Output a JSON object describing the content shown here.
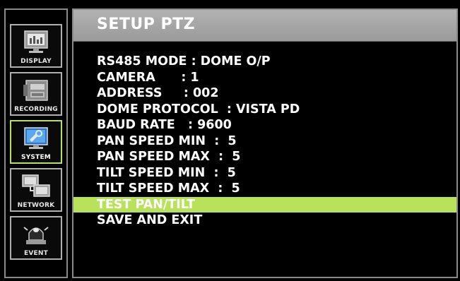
{
  "sidebar": {
    "items": [
      {
        "label": "DISPLAY",
        "icon": "monitor-icon",
        "active": false
      },
      {
        "label": "RECORDING",
        "icon": "recorder-icon",
        "active": false
      },
      {
        "label": "SYSTEM",
        "icon": "system-settings-icon",
        "active": true
      },
      {
        "label": "NETWORK",
        "icon": "network-icon",
        "active": false
      },
      {
        "label": "EVENT",
        "icon": "alarm-light-icon",
        "active": false
      }
    ]
  },
  "header": {
    "title": "SETUP PTZ"
  },
  "menu": {
    "rows": [
      "RS485 MODE : DOME O/P",
      "CAMERA      : 1",
      "ADDRESS     : 002",
      "DOME PROTOCOL  : VISTA PD",
      "BAUD RATE   : 9600",
      "PAN SPEED MIN  :  5",
      "PAN SPEED MAX  :  5",
      "TILT SPEED MIN  :  5",
      "TILT SPEED MAX  :  5",
      "TEST PAN/TILT",
      "SAVE AND EXIT"
    ],
    "selected_index": 9
  },
  "colors": {
    "accent": "#b7e25a",
    "border": "#8a8a8a",
    "header": "#a8a8a8",
    "background": "#000000"
  }
}
